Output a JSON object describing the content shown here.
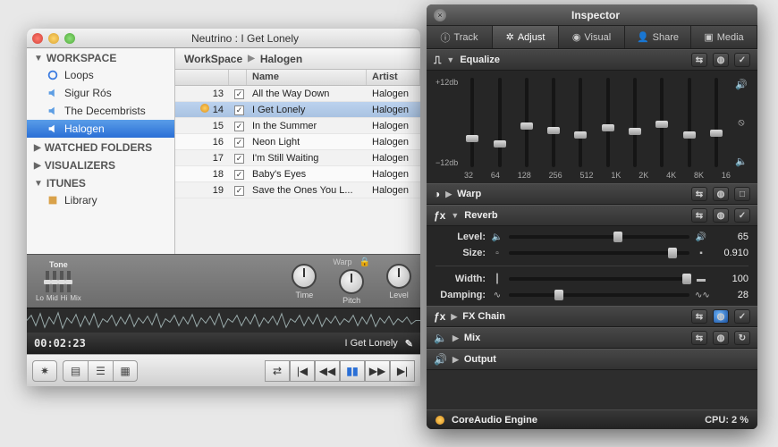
{
  "window": {
    "title": "Neutrino : I Get Lonely"
  },
  "sidebar": {
    "workspace_label": "WORKSPACE",
    "items": [
      {
        "label": "Loops"
      },
      {
        "label": "Sigur Rós"
      },
      {
        "label": "The Decembrists"
      },
      {
        "label": "Halogen"
      }
    ],
    "watched_label": "WATCHED FOLDERS",
    "visualizers_label": "VISUALIZERS",
    "itunes_label": "ITUNES",
    "library_label": "Library"
  },
  "breadcrumb": {
    "a": "WorkSpace",
    "b": "Halogen"
  },
  "columns": {
    "name": "Name",
    "artist": "Artist"
  },
  "tracks": [
    {
      "num": "13",
      "name": "All the Way Down",
      "artist": "Halogen"
    },
    {
      "num": "14",
      "name": "I Get Lonely",
      "artist": "Halogen",
      "playing": true,
      "selected": true
    },
    {
      "num": "15",
      "name": "In the Summer",
      "artist": "Halogen"
    },
    {
      "num": "16",
      "name": "Neon Light",
      "artist": "Halogen"
    },
    {
      "num": "17",
      "name": "I'm Still Waiting",
      "artist": "Halogen"
    },
    {
      "num": "18",
      "name": "Baby's Eyes",
      "artist": "Halogen"
    },
    {
      "num": "19",
      "name": "Save the Ones You L...",
      "artist": "Halogen"
    }
  ],
  "tone": {
    "label": "Tone",
    "sub": [
      "Lo",
      "Mid",
      "Hi",
      "Mix"
    ]
  },
  "knobs": {
    "time": "Time",
    "warp": "Warp",
    "pitch": "Pitch",
    "level": "Level"
  },
  "time": "00:02:23",
  "nowplaying": "I Get Lonely",
  "inspector": {
    "title": "Inspector",
    "tabs": {
      "track": "Track",
      "adjust": "Adjust",
      "visual": "Visual",
      "share": "Share",
      "media": "Media"
    },
    "eq": {
      "label": "Equalize",
      "top_scale": "+12db",
      "bot_scale": "−12db",
      "freqs": [
        "32",
        "64",
        "128",
        "256",
        "512",
        "1K",
        "2K",
        "4K",
        "8K",
        "16"
      ],
      "positions": [
        64,
        70,
        50,
        55,
        60,
        52,
        56,
        48,
        60,
        58
      ]
    },
    "warp": {
      "label": "Warp"
    },
    "reverb": {
      "label": "Reverb",
      "rows": {
        "level": {
          "label": "Level:",
          "value": "65",
          "pos": 58
        },
        "size": {
          "label": "Size:",
          "value": "0.910",
          "pos": 88
        },
        "width": {
          "label": "Width:",
          "value": "100",
          "pos": 96
        },
        "damp": {
          "label": "Damping:",
          "value": "28",
          "pos": 25
        }
      }
    },
    "fxchain": {
      "label": "FX Chain"
    },
    "mix": {
      "label": "Mix"
    },
    "output": {
      "label": "Output"
    },
    "footer": {
      "engine": "CoreAudio Engine",
      "cpu": "CPU: 2 %"
    }
  }
}
